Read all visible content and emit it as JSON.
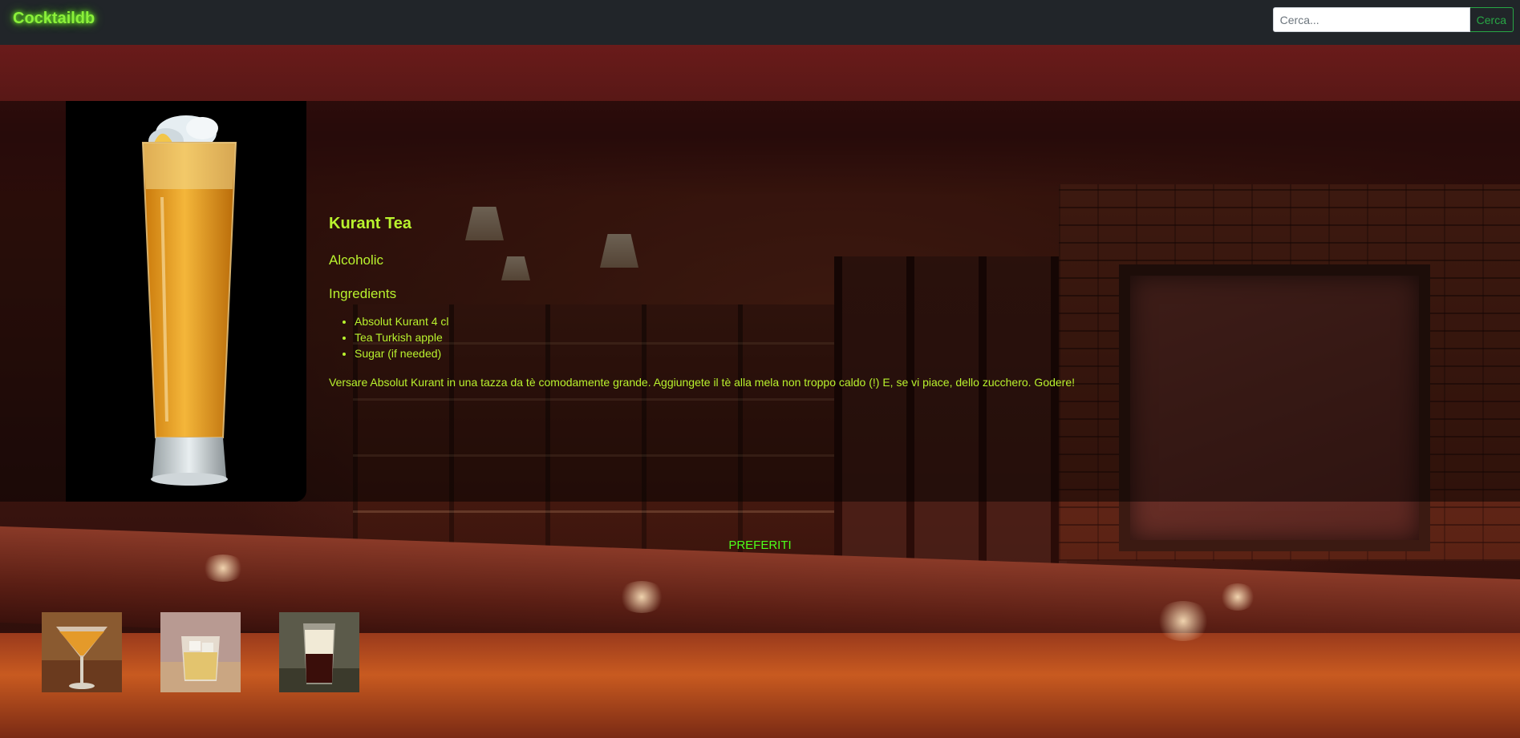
{
  "navbar": {
    "brand": "Cocktaildb",
    "search_placeholder": "Cerca...",
    "search_button": "Cerca"
  },
  "drink": {
    "name": "Kurant Tea",
    "category": "Alcoholic",
    "ingredients_title": "Ingredients",
    "ingredients": [
      "Absolut Kurant 4 cl",
      "Tea Turkish apple",
      "Sugar (if needed)"
    ],
    "instructions": "Versare Absolut Kurant in una tazza da tè comodamente grande. Aggiungete il tè alla mela non troppo caldo (!) E, se vi piace, dello zucchero. Godere!"
  },
  "favorites": {
    "title": "PREFERITI",
    "items": [
      {
        "icon": "martini-glass-thumbnail"
      },
      {
        "icon": "rocks-glass-thumbnail"
      },
      {
        "icon": "layered-shot-thumbnail"
      }
    ]
  },
  "colors": {
    "navbar_bg": "#212529",
    "brand_neon": "#8bf03a",
    "detail_text": "#b9f32e",
    "favorites_neon": "#4cff1a",
    "search_outline": "#28a745"
  }
}
